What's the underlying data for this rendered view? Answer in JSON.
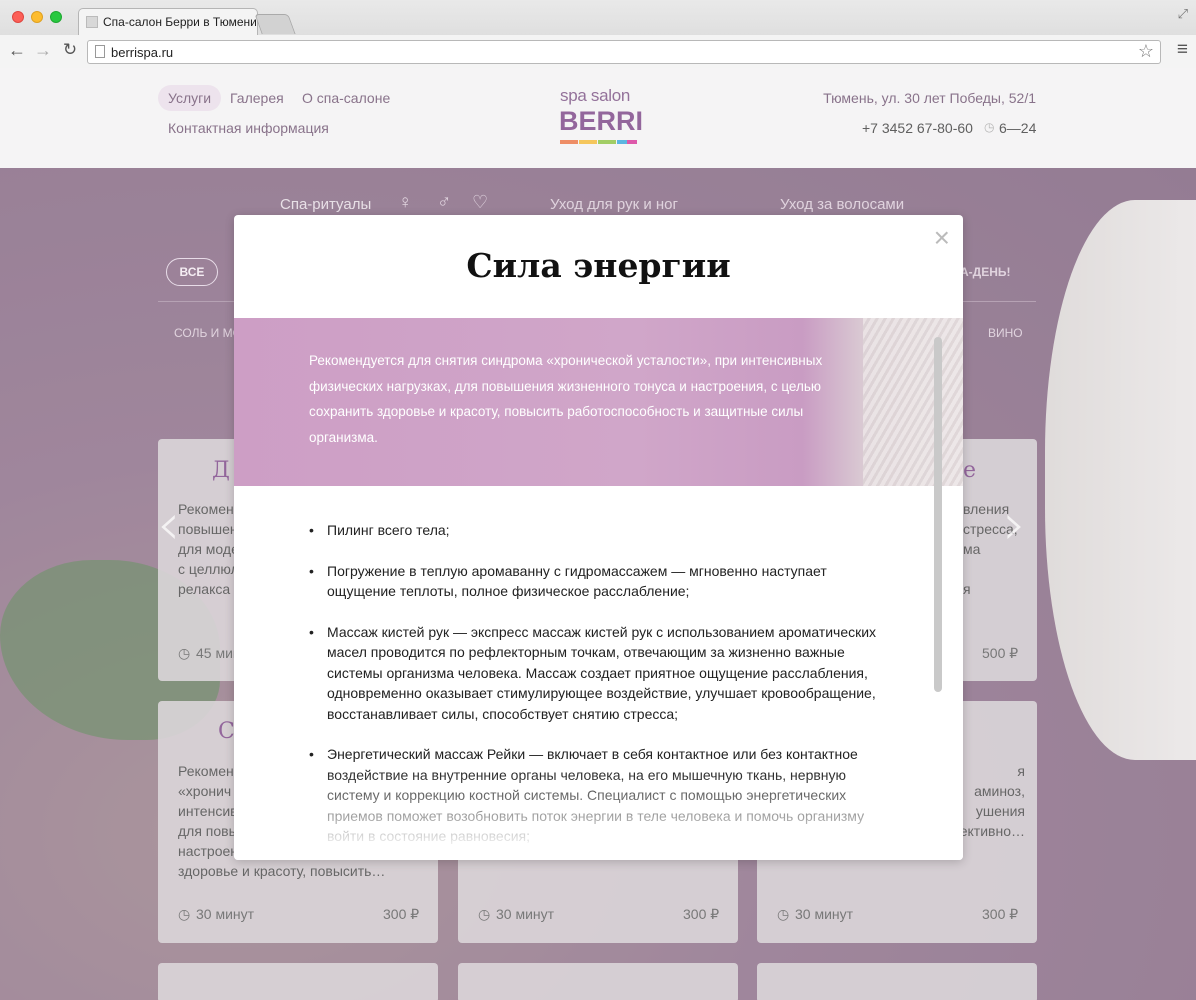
{
  "browser": {
    "tab_title": "Спа-салон Берри в Тюмени",
    "url": "berrispa.ru"
  },
  "site": {
    "nav": [
      "Услуги",
      "Галерея",
      "О спа-салоне",
      "Контактная информация"
    ],
    "logo_line1": "spa salon",
    "logo_line2": "BERRI",
    "logo_colors": [
      "#e8612c",
      "#f2b01e",
      "#7fba2a",
      "#1e9ad6",
      "#d0188a",
      "#5a2e86"
    ],
    "address": "Тюмень, ул. 30 лет Победы, 52/1",
    "phone": "+7 3452 67-80-60",
    "hours": "6—24"
  },
  "background": {
    "category_tabs": [
      "Спа-ритуалы",
      "Уход для рук и ног",
      "Уход за волосами"
    ],
    "filter_all": "ВСЕ",
    "filter_right": "А-ДЕНЬ!",
    "filter_left": "СОЛЬ И МО",
    "filter_right2": "ВИНО",
    "cards": [
      {
        "title": "Д",
        "text": "Рекомен\nповышен\nдля моде\nс целлюл\nрелакса",
        "duration": "45 мин",
        "price": ""
      },
      {
        "title": "е",
        "text": "вления\nстресса,\nма\n\nя",
        "duration": "",
        "price": "500 ₽"
      },
      {
        "title": "С",
        "text": "Рекомен\n«хронич\nинтенсив\nдля повы\nнастроен\nздоровье и красоту, повысить…",
        "duration": "30 минут",
        "price": "300 ₽"
      },
      {
        "title": "",
        "text": "",
        "duration": "30 минут",
        "price": "300 ₽"
      },
      {
        "title": "",
        "text": "я\nаминоз,\nушения\nпозволяет быстро и эффективно…",
        "duration": "30 минут",
        "price": "300 ₽"
      }
    ]
  },
  "modal": {
    "title": "Сила энергии",
    "close_label": "×",
    "intro": "Рекомендуется для снятия синдрома «хронической усталости», при интенсивных физических нагрузках, для повышения жизненного тонуса и настроения, с целью сохранить здоровье и красоту, повысить работоспособность и защитные силы организма.",
    "items": [
      "Пилинг всего тела;",
      "Погружение в теплую аромаванну с гидромассажем — мгновенно наступает ощущение теплоты, полное физическое расслабление;",
      "Массаж кистей рук — экспресс массаж кистей рук с использованием ароматических масел проводится по рефлекторным точкам, отвечающим за жизненно важные системы организма человека. Массаж создает приятное ощущение расслабления, одновременно оказывает стимулирующее воздействие, улучшает кровообращение, восстанавливает силы, способствует снятию стресса;",
      "Энергетический массаж Рейки — включает в себя контактное или без контактное воздействие на внутренние органы человека, на его мышечную ткань, нервную систему и коррекцию костной системы. Специалист с помощью энергетических приемов поможет возобновить поток энергии в теле человека и помочь организму войти в состояние равновесия;"
    ]
  }
}
